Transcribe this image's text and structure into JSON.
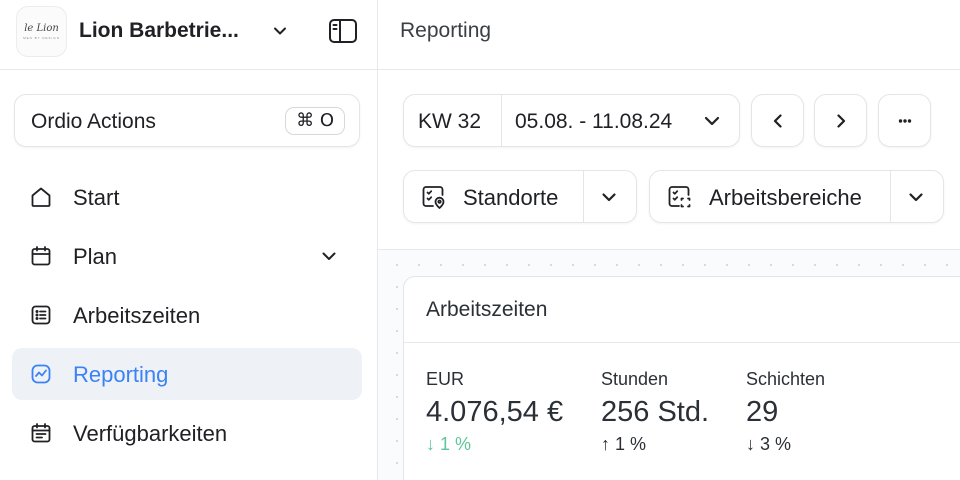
{
  "sidebar": {
    "logo": {
      "script": "le Lion",
      "tagline": "MEN BY DESIGN"
    },
    "tenant_name": "Lion Barbetrie...",
    "actions": {
      "label": "Ordio Actions",
      "shortcut": "⌘ O"
    },
    "items": [
      {
        "label": "Start",
        "icon": "home-icon"
      },
      {
        "label": "Plan",
        "icon": "calendar-icon",
        "expandable": true
      },
      {
        "label": "Arbeitszeiten",
        "icon": "list-icon"
      },
      {
        "label": "Reporting",
        "icon": "chart-icon",
        "active": true
      },
      {
        "label": "Verfügbarkeiten",
        "icon": "calendar-list-icon"
      }
    ]
  },
  "header": {
    "title": "Reporting"
  },
  "toolbar": {
    "week_label": "KW 32",
    "date_range": "05.08. - 11.08.24",
    "filters": [
      {
        "label": "Standorte",
        "icon": "location-checklist-icon"
      },
      {
        "label": "Arbeitsbereiche",
        "icon": "area-checklist-icon"
      }
    ]
  },
  "card": {
    "title": "Arbeitszeiten",
    "metrics": [
      {
        "label": "EUR",
        "value": "4.076,54 €",
        "change": "↓ 1 %",
        "tone": "positive"
      },
      {
        "label": "Stunden",
        "value": "256 Std.",
        "change": "↑ 1 %",
        "tone": "neutral"
      },
      {
        "label": "Schichten",
        "value": "29",
        "change": "↓ 3 %",
        "tone": "neutral"
      }
    ]
  },
  "colors": {
    "accent": "#3b82f6",
    "active_bg": "#eef2f7",
    "positive": "#5ec79a",
    "border": "#e3e5e8"
  }
}
